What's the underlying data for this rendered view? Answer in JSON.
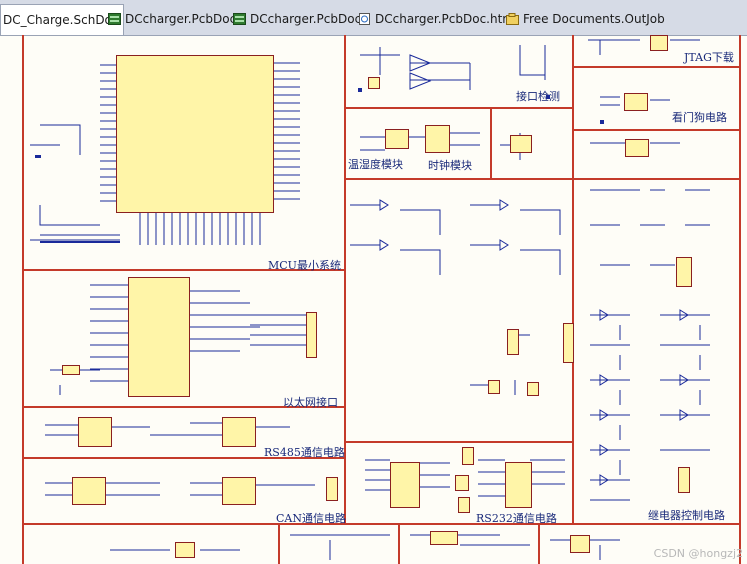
{
  "tabs": [
    {
      "label": "DC_Charge.SchDoc",
      "icon": "schematic-doc-icon",
      "active": true
    },
    {
      "label": "DCcharger.PcbDoc",
      "icon": "pcb-doc-icon",
      "active": false
    },
    {
      "label": "DCcharger.PcbDoc",
      "icon": "pcb-doc-icon",
      "active": false
    },
    {
      "label": "DCcharger.PcbDoc.htm",
      "icon": "html-doc-icon",
      "active": false
    },
    {
      "label": "Free Documents.OutJob",
      "icon": "outjob-doc-icon",
      "active": false
    }
  ],
  "blocks": {
    "jtag": "JTAG下载",
    "port_detect": "接口检测",
    "watchdog": "看门狗电路",
    "temp_humidity": "温湿度模块",
    "clock": "时钟模块",
    "mcu": "MCU最小系统",
    "ethernet": "以太网接口",
    "rs485": "RS485通信电路",
    "can": "CAN通信电路",
    "rs232": "RS232通信电路",
    "relay": "继电器控制电路"
  },
  "watermark": "CSDN @hongzj2",
  "colors": {
    "divider": "#c43a2a",
    "wire": "#1a2a9a",
    "chip_fill": "#fff5a8",
    "label": "#1a2a7a",
    "background": "#fefdf7"
  }
}
